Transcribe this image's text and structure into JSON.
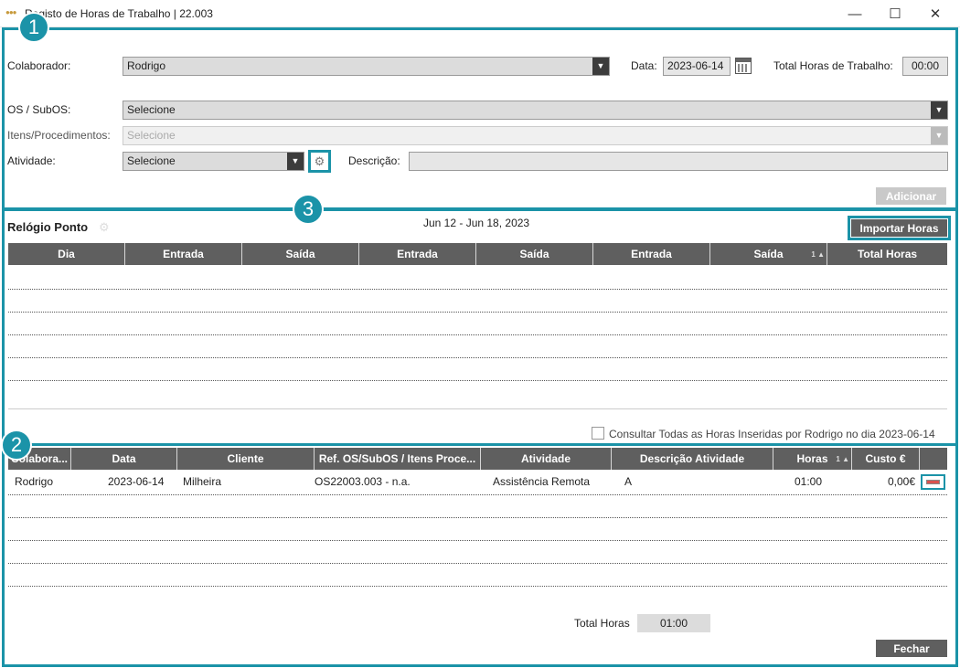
{
  "window": {
    "title": "Registo de Horas de Trabalho | 22.003",
    "minimize": "—",
    "maximize": "☐",
    "close": "✕"
  },
  "callouts": [
    "1",
    "2",
    "3"
  ],
  "form": {
    "colaborador_label": "Colaborador:",
    "colaborador_value": "Rodrigo",
    "data_label": "Data:",
    "data_value": "2023-06-14",
    "total_label": "Total Horas de Trabalho:",
    "total_value": "00:00",
    "os_label": "OS / SubOS:",
    "os_value": "Selecione",
    "itens_label": "Itens/Procedimentos:",
    "itens_value": "Selecione",
    "atividade_label": "Atividade:",
    "atividade_value": "Selecione",
    "descricao_label": "Descrição:",
    "descricao_value": "",
    "adicionar": "Adicionar"
  },
  "relogio": {
    "title": "Relógio Ponto",
    "week": "Jun 12 - Jun 18, 2023",
    "importar": "Importar Horas",
    "columns": [
      "Dia",
      "Entrada",
      "Saída",
      "Entrada",
      "Saída",
      "Entrada",
      "Saída",
      "Total Horas"
    ],
    "sort_indicator": "1 ▲",
    "consult_label": "Consultar Todas as Horas Inseridas por Rodrigo no dia 2023-06-14",
    "consult_checked": false
  },
  "hours": {
    "columns": [
      "Colabora...",
      "Data",
      "Cliente",
      "Ref. OS/SubOS / Itens Proce...",
      "Atividade",
      "Descrição Atividade",
      "Horas",
      "Custo €"
    ],
    "sort_indicator": "1 ▲",
    "rows": [
      {
        "colaborador": "Rodrigo",
        "data": "2023-06-14",
        "cliente": "Milheira",
        "ref": "OS22003.003 - n.a.",
        "atividade": "Assistência Remota",
        "descricao": "A",
        "horas": "01:00",
        "custo": "0,00€"
      }
    ],
    "total_label": "Total Horas",
    "total_value": "01:00",
    "fechar": "Fechar"
  },
  "colors": {
    "accent": "#1b93a8",
    "header": "#5f5f5f"
  }
}
